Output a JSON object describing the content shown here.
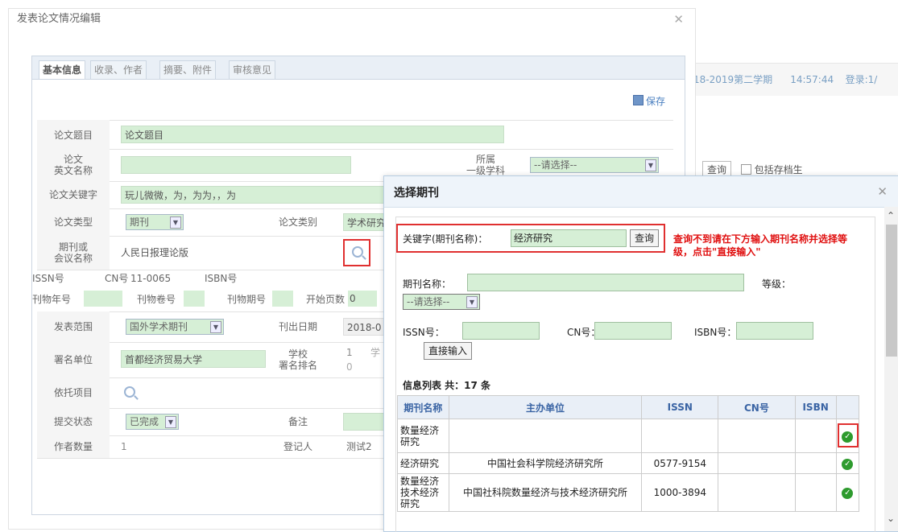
{
  "background": {
    "semester": "18-2019第二学期",
    "time": "14:57:44",
    "login": "登录:1/",
    "query_button": "查询",
    "archive_checkbox": "包括存档生"
  },
  "dialog": {
    "title": "发表论文情况编辑",
    "tabs": [
      {
        "label": "基本信息"
      },
      {
        "label": "收录、作者"
      },
      {
        "label": "摘要、附件"
      },
      {
        "label": "审核意见"
      }
    ],
    "save_label": "保存",
    "form": {
      "title_label": "论文题目",
      "title_value": "论文题目",
      "en_name_label": "论文\n英文名称",
      "subject_label": "所属\n一级学科",
      "subject_select": "--请选择--",
      "keywords_label": "论文关键字",
      "keywords_value": "玩儿微微，为，为为，，为",
      "type_label": "论文类型",
      "type_select": "期刊",
      "category_label": "论文类别",
      "category_value": "学术研究",
      "journal_label": "期刊或\n会议名称",
      "journal_value": "人民日报理论版",
      "issn_label": "ISSN号",
      "cn_label": "CN号",
      "cn_value": "11-0065",
      "isbn_label": "ISBN号",
      "year_label": "刊物年号",
      "volume_label": "刊物卷号",
      "issue_label": "刊物期号",
      "start_page_label": "开始页数",
      "start_page_value": "0",
      "scope_label": "发表范围",
      "scope_select": "国外学术期刊",
      "pub_date_label": "刊出日期",
      "pub_date_value": "2018-0",
      "unit_label": "署名单位",
      "unit_value": "首都经济贸易大学",
      "school_rank_label": "学校\n署名排名",
      "school_rank_value": "1",
      "school_rank_sub": "0",
      "school_rank_extra": "学",
      "project_label": "依托项目",
      "status_label": "提交状态",
      "status_select": "已完成",
      "remark_label": "备注",
      "author_count_label": "作者数量",
      "author_count_value": "1",
      "registrant_label": "登记人",
      "registrant_value": "测试2"
    }
  },
  "popup": {
    "title": "选择期刊",
    "keyword_label": "关键字(期刊名称)：",
    "keyword_value": "经济研究",
    "query_button": "查询",
    "warning": "查询不到请在下方输入期刊名称并选择等级，点击\"直接输入\"",
    "journal_name_label": "期刊名称：",
    "level_label": "等级：",
    "level_select": "--请选择--",
    "issn_label": "ISSN号：",
    "cn_label": "CN号：",
    "isbn_label": "ISBN号：",
    "direct_input_button": "直接输入",
    "list_title": "信息列表 共：17 条",
    "columns": [
      "期刊名称",
      "主办单位",
      "ISSN",
      "CN号",
      "ISBN",
      ""
    ],
    "rows": [
      {
        "name": "数量经济\n研究",
        "unit": "",
        "issn": "",
        "cn": "",
        "isbn": ""
      },
      {
        "name": "经济研究",
        "unit": "中国社会科学院经济研究所",
        "issn": "0577-9154",
        "cn": "",
        "isbn": ""
      },
      {
        "name": "数量经济\n技术经济\n研究",
        "unit": "中国社科院数量经济与技术经济研究所",
        "issn": "1000-3894",
        "cn": "",
        "isbn": ""
      }
    ]
  },
  "colors": {
    "highlight_box": "#e03030",
    "input_green": "#d6efd6",
    "check_green": "#2e9b2e",
    "header_blue": "#3a64a4"
  }
}
